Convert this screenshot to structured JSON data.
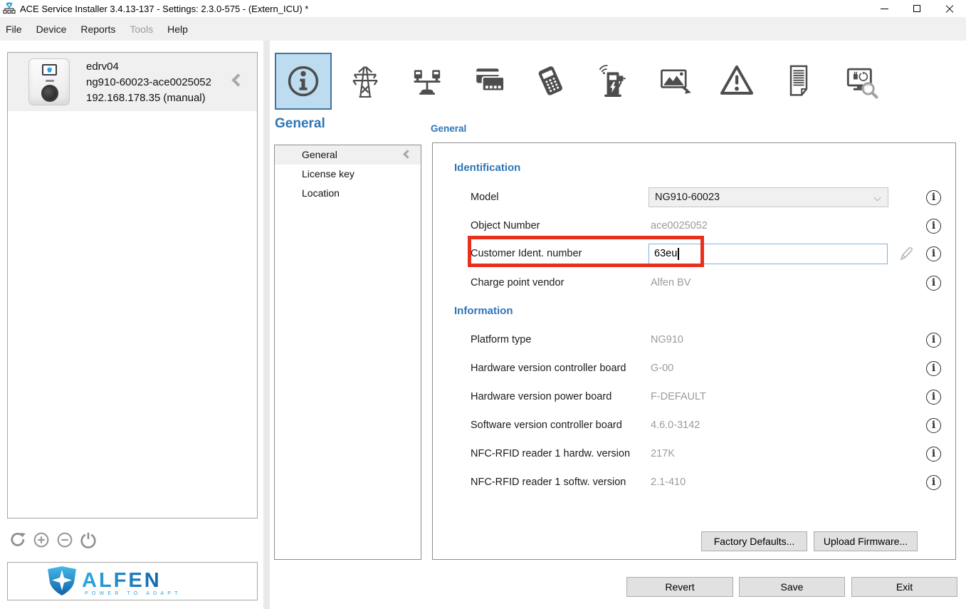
{
  "window": {
    "title": "ACE Service Installer 3.4.13-137 - Settings: 2.3.0-575 -  (Extern_ICU) *"
  },
  "menu": {
    "items": [
      {
        "label": "File",
        "enabled": true
      },
      {
        "label": "Device",
        "enabled": true
      },
      {
        "label": "Reports",
        "enabled": true
      },
      {
        "label": "Tools",
        "enabled": false
      },
      {
        "label": "Help",
        "enabled": true
      }
    ]
  },
  "sidebar": {
    "device": {
      "name": "edrv04",
      "serial": "ng910-60023-ace0025052",
      "address": "192.168.178.35 (manual)"
    },
    "logo": {
      "brand": "ALFEN",
      "tagline": "POWER TO ADAPT"
    }
  },
  "toolbar": {
    "tabs": [
      {
        "name": "general",
        "icon": "info-icon",
        "selected": true
      },
      {
        "name": "power-grid",
        "icon": "transmission-tower-icon",
        "selected": false
      },
      {
        "name": "load-balancing",
        "icon": "load-balancing-icon",
        "selected": false
      },
      {
        "name": "payment-cards",
        "icon": "credit-cards-icon",
        "selected": false
      },
      {
        "name": "payment-terminal",
        "icon": "payment-terminal-icon",
        "selected": false
      },
      {
        "name": "connectivity",
        "icon": "charging-station-signal-icon",
        "selected": false
      },
      {
        "name": "display",
        "icon": "display-image-icon",
        "selected": false
      },
      {
        "name": "warnings",
        "icon": "warning-triangle-icon",
        "selected": false
      },
      {
        "name": "logs",
        "icon": "document-icon",
        "selected": false
      },
      {
        "name": "diagnostics",
        "icon": "monitor-search-icon",
        "selected": false
      }
    ]
  },
  "nav": {
    "title": "General",
    "items": [
      "General",
      "License key",
      "Location"
    ],
    "selected_index": 0
  },
  "panel": {
    "title": "General",
    "sections": [
      {
        "title": "Identification",
        "rows": [
          {
            "label": "Model",
            "value": "NG910-60023",
            "control": "dropdown"
          },
          {
            "label": "Object Number",
            "value": "ace0025052",
            "control": "readonly"
          },
          {
            "label": "Customer Ident. number",
            "value": "63eu",
            "control": "text-input"
          },
          {
            "label": "Charge point vendor",
            "value": "Alfen BV",
            "control": "readonly"
          }
        ]
      },
      {
        "title": "Information",
        "rows": [
          {
            "label": "Platform type",
            "value": "NG910"
          },
          {
            "label": "Hardware version controller board",
            "value": "G-00"
          },
          {
            "label": "Hardware version power board",
            "value": "F-DEFAULT"
          },
          {
            "label": "Software version controller board",
            "value": "4.6.0-3142"
          },
          {
            "label": "NFC-RFID reader 1 hardw. version",
            "value": "217K"
          },
          {
            "label": "NFC-RFID reader 1 softw. version",
            "value": "2.1-410"
          }
        ]
      }
    ],
    "buttons": {
      "factory_defaults": "Factory Defaults...",
      "upload_firmware": "Upload Firmware..."
    }
  },
  "footer": {
    "revert": "Revert",
    "save": "Save",
    "exit": "Exit"
  },
  "icons": {
    "info_glyph": "i"
  },
  "colors": {
    "accent_blue": "#2e75b6",
    "annotation_red": "#e8301d",
    "selected_tab_bg": "#bedcf0",
    "selected_tab_border": "#44749c",
    "input_focus_border": "#7fb2de",
    "muted_text": "#9b9b9b"
  }
}
